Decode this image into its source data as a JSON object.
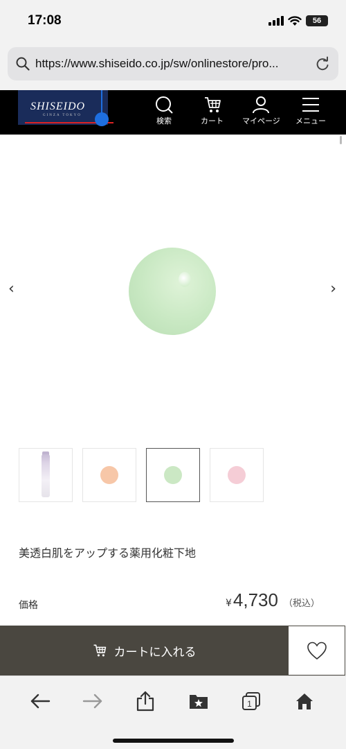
{
  "status": {
    "time": "17:08",
    "battery": "56"
  },
  "browser": {
    "url": "https://www.shiseido.co.jp/sw/onlinestore/pro..."
  },
  "site": {
    "logo": "SHISEIDO",
    "logo_sub": "GINZA TOKYO",
    "nav": [
      {
        "label": "検索",
        "icon": "search-icon"
      },
      {
        "label": "カート",
        "icon": "cart-icon"
      },
      {
        "label": "マイページ",
        "icon": "user-icon"
      },
      {
        "label": "メニュー",
        "icon": "menu-icon"
      }
    ]
  },
  "product": {
    "description": "美透白肌をアップする薬用化粧下地",
    "price_label": "価格",
    "price_currency": "¥",
    "price": "4,730",
    "price_tax": "（税込）",
    "thumbnails": [
      {
        "name": "tube",
        "color": "#ddd4e6"
      },
      {
        "name": "orange-swatch",
        "color": "#f7c7a8"
      },
      {
        "name": "green-swatch",
        "color": "#cbe8c4"
      },
      {
        "name": "pink-swatch",
        "color": "#f5cdd6"
      }
    ],
    "selected_thumbnail": 2
  },
  "actions": {
    "add_to_cart": "カートに入れる"
  }
}
